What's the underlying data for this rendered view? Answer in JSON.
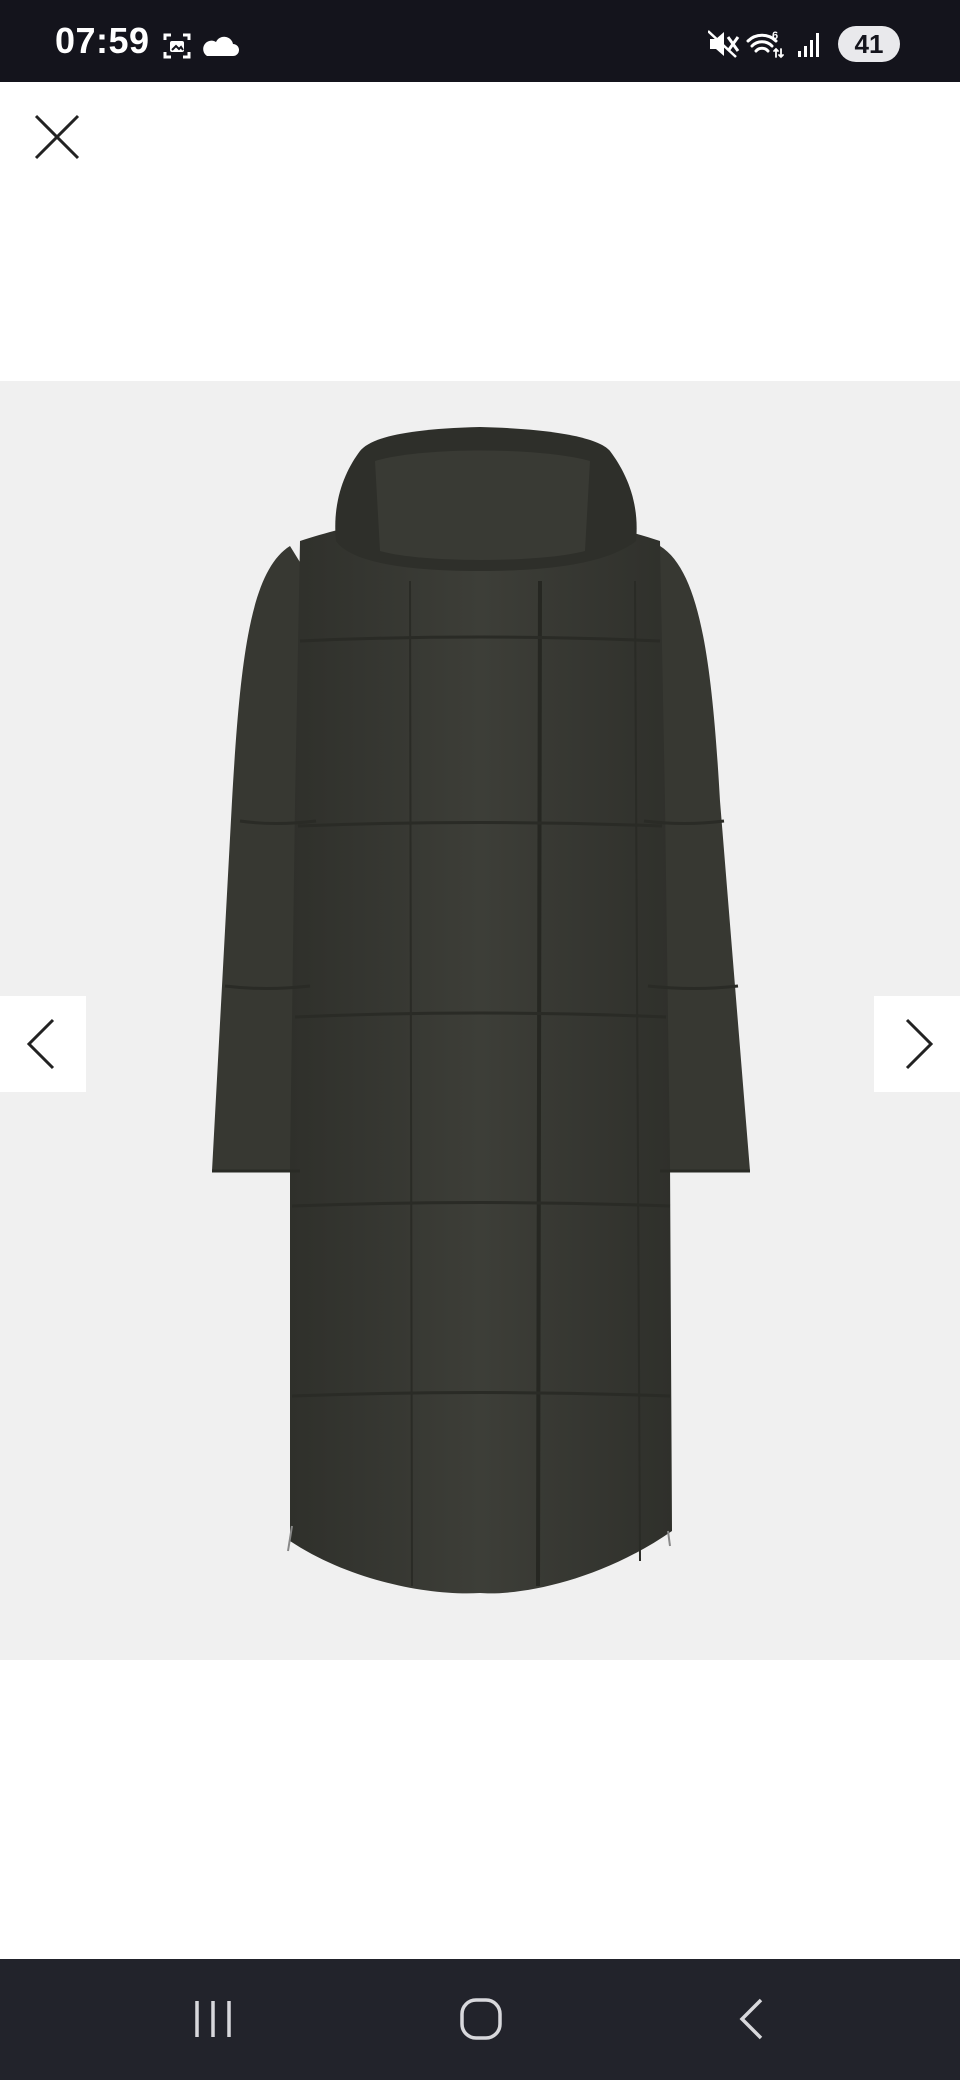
{
  "status_bar": {
    "time": "07:59",
    "battery": "41",
    "icons": [
      "screenshot-icon",
      "cloud-icon",
      "mute-icon",
      "wifi-icon",
      "signal-icon"
    ]
  },
  "viewer": {
    "close_icon": "close-icon",
    "prev_icon": "chevron-left-icon",
    "next_icon": "chevron-right-icon",
    "image_subject": "long-hooded-puffer-coat",
    "coat_color": "#3b3c36",
    "background_color": "#f0f0f0"
  },
  "system_nav": {
    "buttons": [
      "recent-apps-icon",
      "home-icon",
      "back-icon"
    ]
  }
}
